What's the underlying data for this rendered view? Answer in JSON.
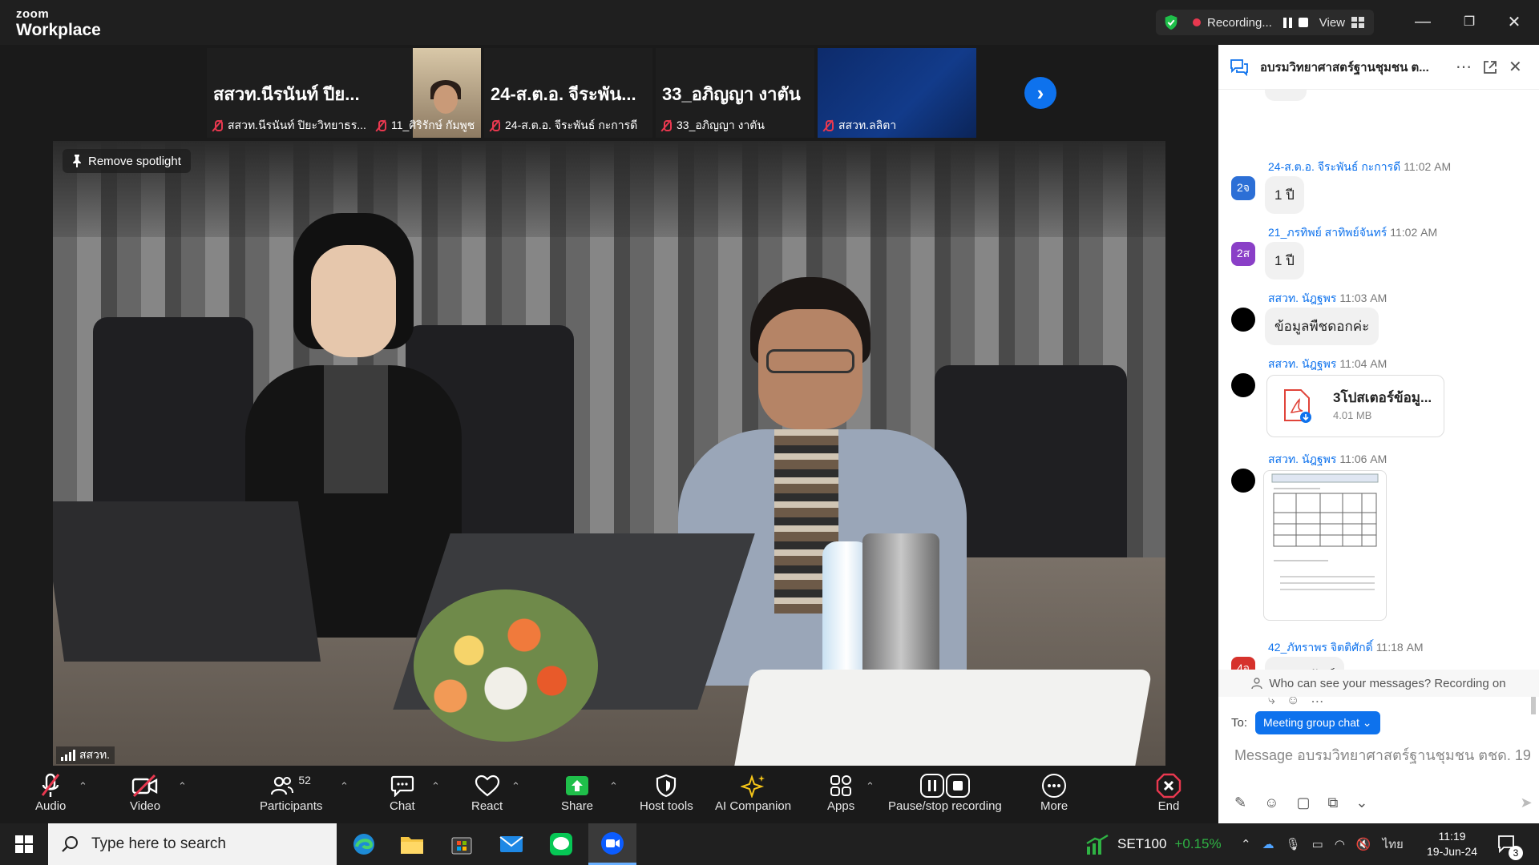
{
  "app": {
    "brand_line1": "zoom",
    "brand_line2": "Workplace"
  },
  "titlebar": {
    "recording_label": "Recording...",
    "view_label": "View",
    "minimize_glyph": "—",
    "restore_glyph": "❐",
    "close_glyph": "✕"
  },
  "gallery": {
    "tiles": [
      {
        "big_name": "สสวท.นีรนันท์ ปีย...",
        "label": "สสวท.นีรนันท์ ปิยะวิทยาธร..."
      },
      {
        "big_name": "",
        "label": "11_ศิริรักษ์ กัมพูช"
      },
      {
        "big_name": "24-ส.ต.อ. จีระพัน...",
        "label": "24-ส.ต.อ. จีระพันธ์ กะการดี"
      },
      {
        "big_name": "33_อภิญญา งาตัน",
        "label": "33_อภิญญา งาตัน"
      },
      {
        "big_name": "",
        "label": "สสวท.ลลิตา"
      }
    ],
    "next_glyph": "›"
  },
  "spotlight": {
    "remove_label": "Remove spotlight",
    "speaker_name": "สสวท."
  },
  "controls": {
    "audio": "Audio",
    "video": "Video",
    "participants": "Participants",
    "participants_count": "52",
    "chat": "Chat",
    "react": "React",
    "share": "Share",
    "host_tools": "Host tools",
    "ai_companion": "AI Companion",
    "apps": "Apps",
    "pause_stop_recording": "Pause/stop recording",
    "more": "More",
    "end": "End"
  },
  "chat": {
    "title": "อบรมวิทยาศาสตร์ฐานชุมชน ต...",
    "messages": [
      {
        "avatar": "2จ",
        "avatar_color": "#2c6fd6",
        "sender": "24-ส.ต.อ. จีระพันธ์ กะการดี",
        "time": "11:02 AM",
        "text": "1 ปี"
      },
      {
        "avatar": "2ส",
        "avatar_color": "#8a3fc7",
        "sender": "21_ภรทิพย์ สาทิพย์จันทร์",
        "time": "11:02 AM",
        "text": "1 ปี"
      },
      {
        "avatar": "",
        "avatar_color": "#000000",
        "sender": "สสวท. นัฎฐพร",
        "time": "11:03 AM",
        "text": "ข้อมูลพืชดอกค่ะ"
      },
      {
        "avatar": "",
        "avatar_color": "#000000",
        "sender": "สสวท. นัฎฐพร",
        "time": "11:04 AM",
        "file_name": "3โปสเตอร์ข้อมู...",
        "file_size": "4.01 MB"
      },
      {
        "avatar": "",
        "avatar_color": "#000000",
        "sender": "สสวท. นัฎฐพร",
        "time": "11:06 AM"
      },
      {
        "avatar": "4จ",
        "avatar_color": "#d6322c",
        "sender": "42_ภัทราพร จิตติศักดิ์",
        "time": "11:18 AM",
        "text": "กุมภาพันธ์"
      }
    ],
    "notice": "Who can see your messages? Recording on",
    "to_label": "To:",
    "to_target": "Meeting group chat",
    "input_placeholder": "Message อบรมวิทยาศาสตร์ฐานชุมชน ตชด. 19..."
  },
  "taskbar": {
    "search_placeholder": "Type here to search",
    "stock_name": "SET100",
    "stock_change": "+0.15%",
    "language": "ไทย",
    "time": "11:19",
    "date": "19-Jun-24",
    "notification_count": "3"
  }
}
